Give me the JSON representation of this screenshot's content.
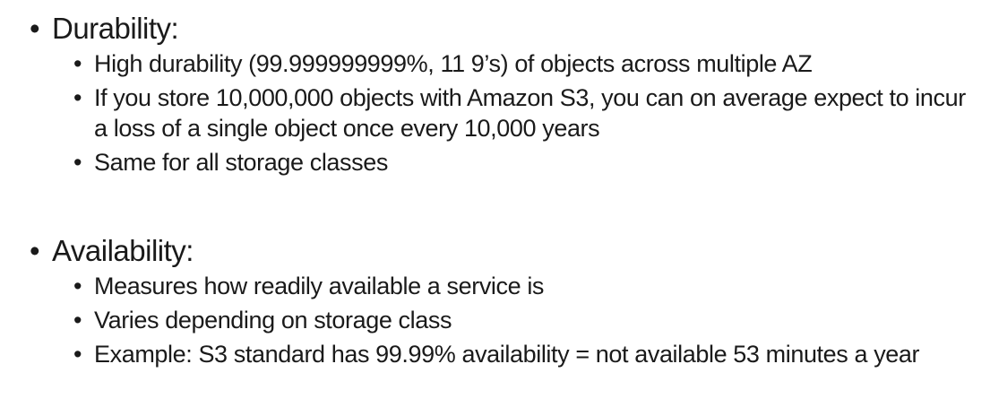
{
  "bullet_glyph": "•",
  "durability": {
    "heading": "Durability:",
    "items": [
      "High durability (99.999999999%, 11 9’s) of objects across multiple AZ",
      "If you store 10,000,000 objects with Amazon S3, you can on average expect to incur a loss of a single object once every 10,000 years",
      "Same for all storage classes"
    ]
  },
  "availability": {
    "heading": "Availability:",
    "items": [
      "Measures how readily available a service is",
      "Varies depending on storage class",
      "Example: S3 standard has 99.99% availability = not available 53 minutes a year"
    ]
  }
}
